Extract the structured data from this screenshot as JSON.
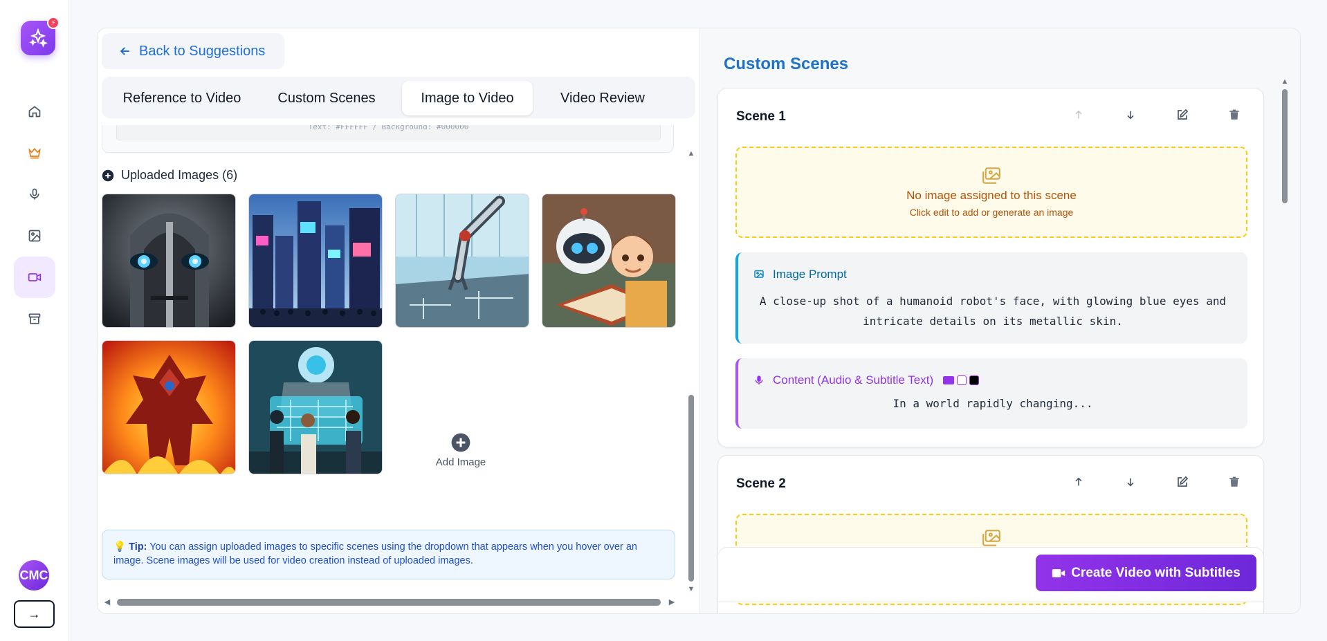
{
  "sidebar": {
    "items": [
      {
        "name": "home",
        "icon": "home-icon"
      },
      {
        "name": "premium",
        "icon": "crown-icon"
      },
      {
        "name": "audio",
        "icon": "microphone-icon"
      },
      {
        "name": "images",
        "icon": "image-icon"
      },
      {
        "name": "video",
        "icon": "video-camera-icon",
        "active": true
      },
      {
        "name": "archive",
        "icon": "archive-box-icon"
      }
    ],
    "avatar_initials": "CMC",
    "collapse_label": "→",
    "logo_badge": "⚡"
  },
  "header": {
    "back_label": "Back to Suggestions"
  },
  "tabs": [
    {
      "label": "Reference to Video",
      "active": false
    },
    {
      "label": "Custom Scenes",
      "active": false
    },
    {
      "label": "Image to Video",
      "active": true
    },
    {
      "label": "Video Review",
      "active": false
    }
  ],
  "code_strip_text": "Text: #FFFFFF / Background: #000000",
  "uploads": {
    "heading": "Uploaded Images (6)",
    "images": [
      {
        "alt": "Robot face with glowing blue eyes"
      },
      {
        "alt": "Futuristic neon city street"
      },
      {
        "alt": "Robotic arm on circuit board"
      },
      {
        "alt": "Cartoon robot reading with boy"
      },
      {
        "alt": "Robot in flames"
      },
      {
        "alt": "Kids in front of holographic robot display"
      }
    ],
    "add_label": "Add Image"
  },
  "tip": {
    "prefix": "Tip:",
    "text": "You can assign uploaded images to specific scenes using the dropdown that appears when you hover over an image. Scene images will be used for video creation instead of uploaded images."
  },
  "custom_scenes": {
    "title": "Custom Scenes",
    "scenes": [
      {
        "title": "Scene 1",
        "no_image_title": "No image assigned to this scene",
        "no_image_hint": "Click edit to add or generate an image",
        "prompt_label": "Image Prompt",
        "prompt": "A close-up shot of a humanoid robot's face, with glowing blue eyes and intricate details on its metallic skin.",
        "content_label": "Content (Audio & Subtitle Text)",
        "content": "In a world rapidly changing..."
      },
      {
        "title": "Scene 2"
      }
    ],
    "create_button": "Create Video with Subtitles"
  },
  "colors": {
    "accent_blue": "#1e73c8",
    "accent_purple": "#9333ea",
    "warn_yellow": "#facc15"
  }
}
